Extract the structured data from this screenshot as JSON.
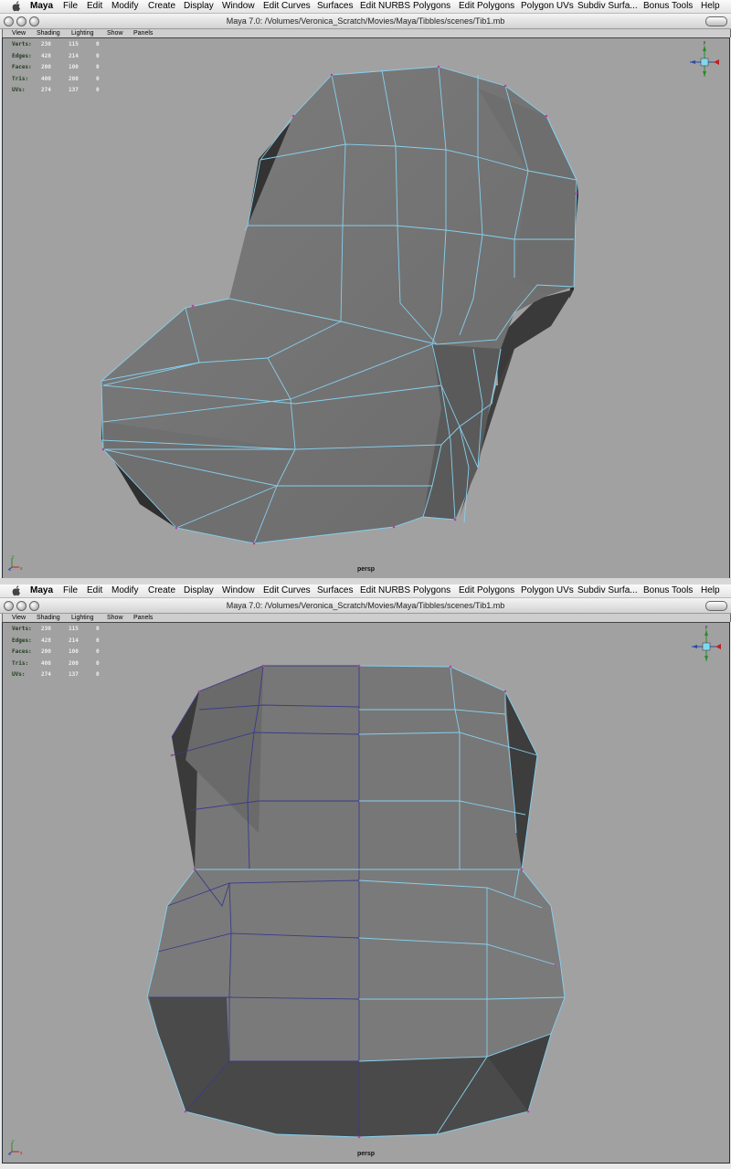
{
  "menu": {
    "app": "Maya",
    "items": [
      "File",
      "Edit",
      "Modify",
      "Create",
      "Display",
      "Window",
      "Edit Curves",
      "Surfaces",
      "Edit NURBS",
      "Polygons",
      "Edit Polygons",
      "Polygon UVs",
      "Subdiv Surfa...",
      "Bonus Tools",
      "Help"
    ]
  },
  "window": {
    "title": "Maya 7.0:  /Volumes/Veronica_Scratch/Movies/Maya/Tibbles/scenes/Tib1.mb"
  },
  "panel_menu": [
    "View",
    "Shading",
    "Lighting",
    "Show",
    "Panels"
  ],
  "hud": [
    {
      "label": "Verts:",
      "v1": "230",
      "v2": "115",
      "v3": "0"
    },
    {
      "label": "Edges:",
      "v1": "428",
      "v2": "214",
      "v3": "0"
    },
    {
      "label": "Faces:",
      "v1": "200",
      "v2": "100",
      "v3": "0"
    },
    {
      "label": "Tris:",
      "v1": "400",
      "v2": "200",
      "v3": "0"
    },
    {
      "label": "UVs:",
      "v1": "274",
      "v2": "137",
      "v3": "0"
    }
  ],
  "camera": "persp",
  "axis": {
    "y": "y",
    "z": "z",
    "x": "x"
  },
  "colors": {
    "viewport": "#a1a1a1",
    "wire": "#7ec8e8",
    "wire_dark": "#3a3a8c",
    "mesh": "#7a7a7a",
    "hud_label": "#213e21"
  }
}
